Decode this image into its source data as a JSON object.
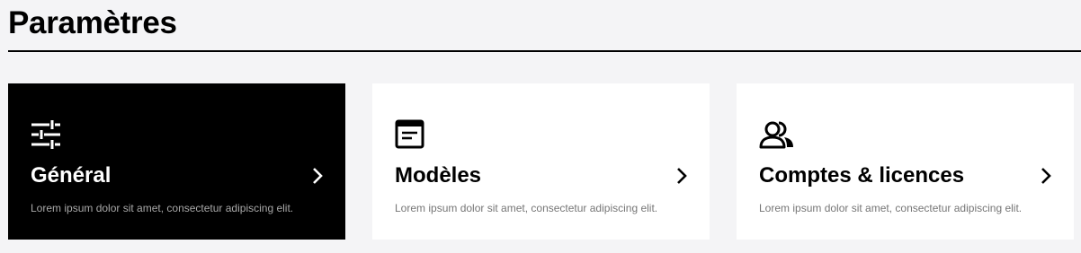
{
  "page": {
    "title": "Paramètres"
  },
  "cards": [
    {
      "title": "Général",
      "description": "Lorem ipsum dolor sit amet, consectetur adipiscing elit.",
      "icon": "sliders-icon",
      "active": true
    },
    {
      "title": "Modèles",
      "description": "Lorem ipsum dolor sit amet, consectetur adipiscing elit.",
      "icon": "template-icon",
      "active": false
    },
    {
      "title": "Comptes & licences",
      "description": "Lorem ipsum dolor sit amet, consectetur adipiscing elit.",
      "icon": "users-icon",
      "active": false
    }
  ],
  "colors": {
    "background": "#f4f4f6",
    "active_card": "#000000",
    "card": "#ffffff",
    "description_text": "#767676"
  }
}
